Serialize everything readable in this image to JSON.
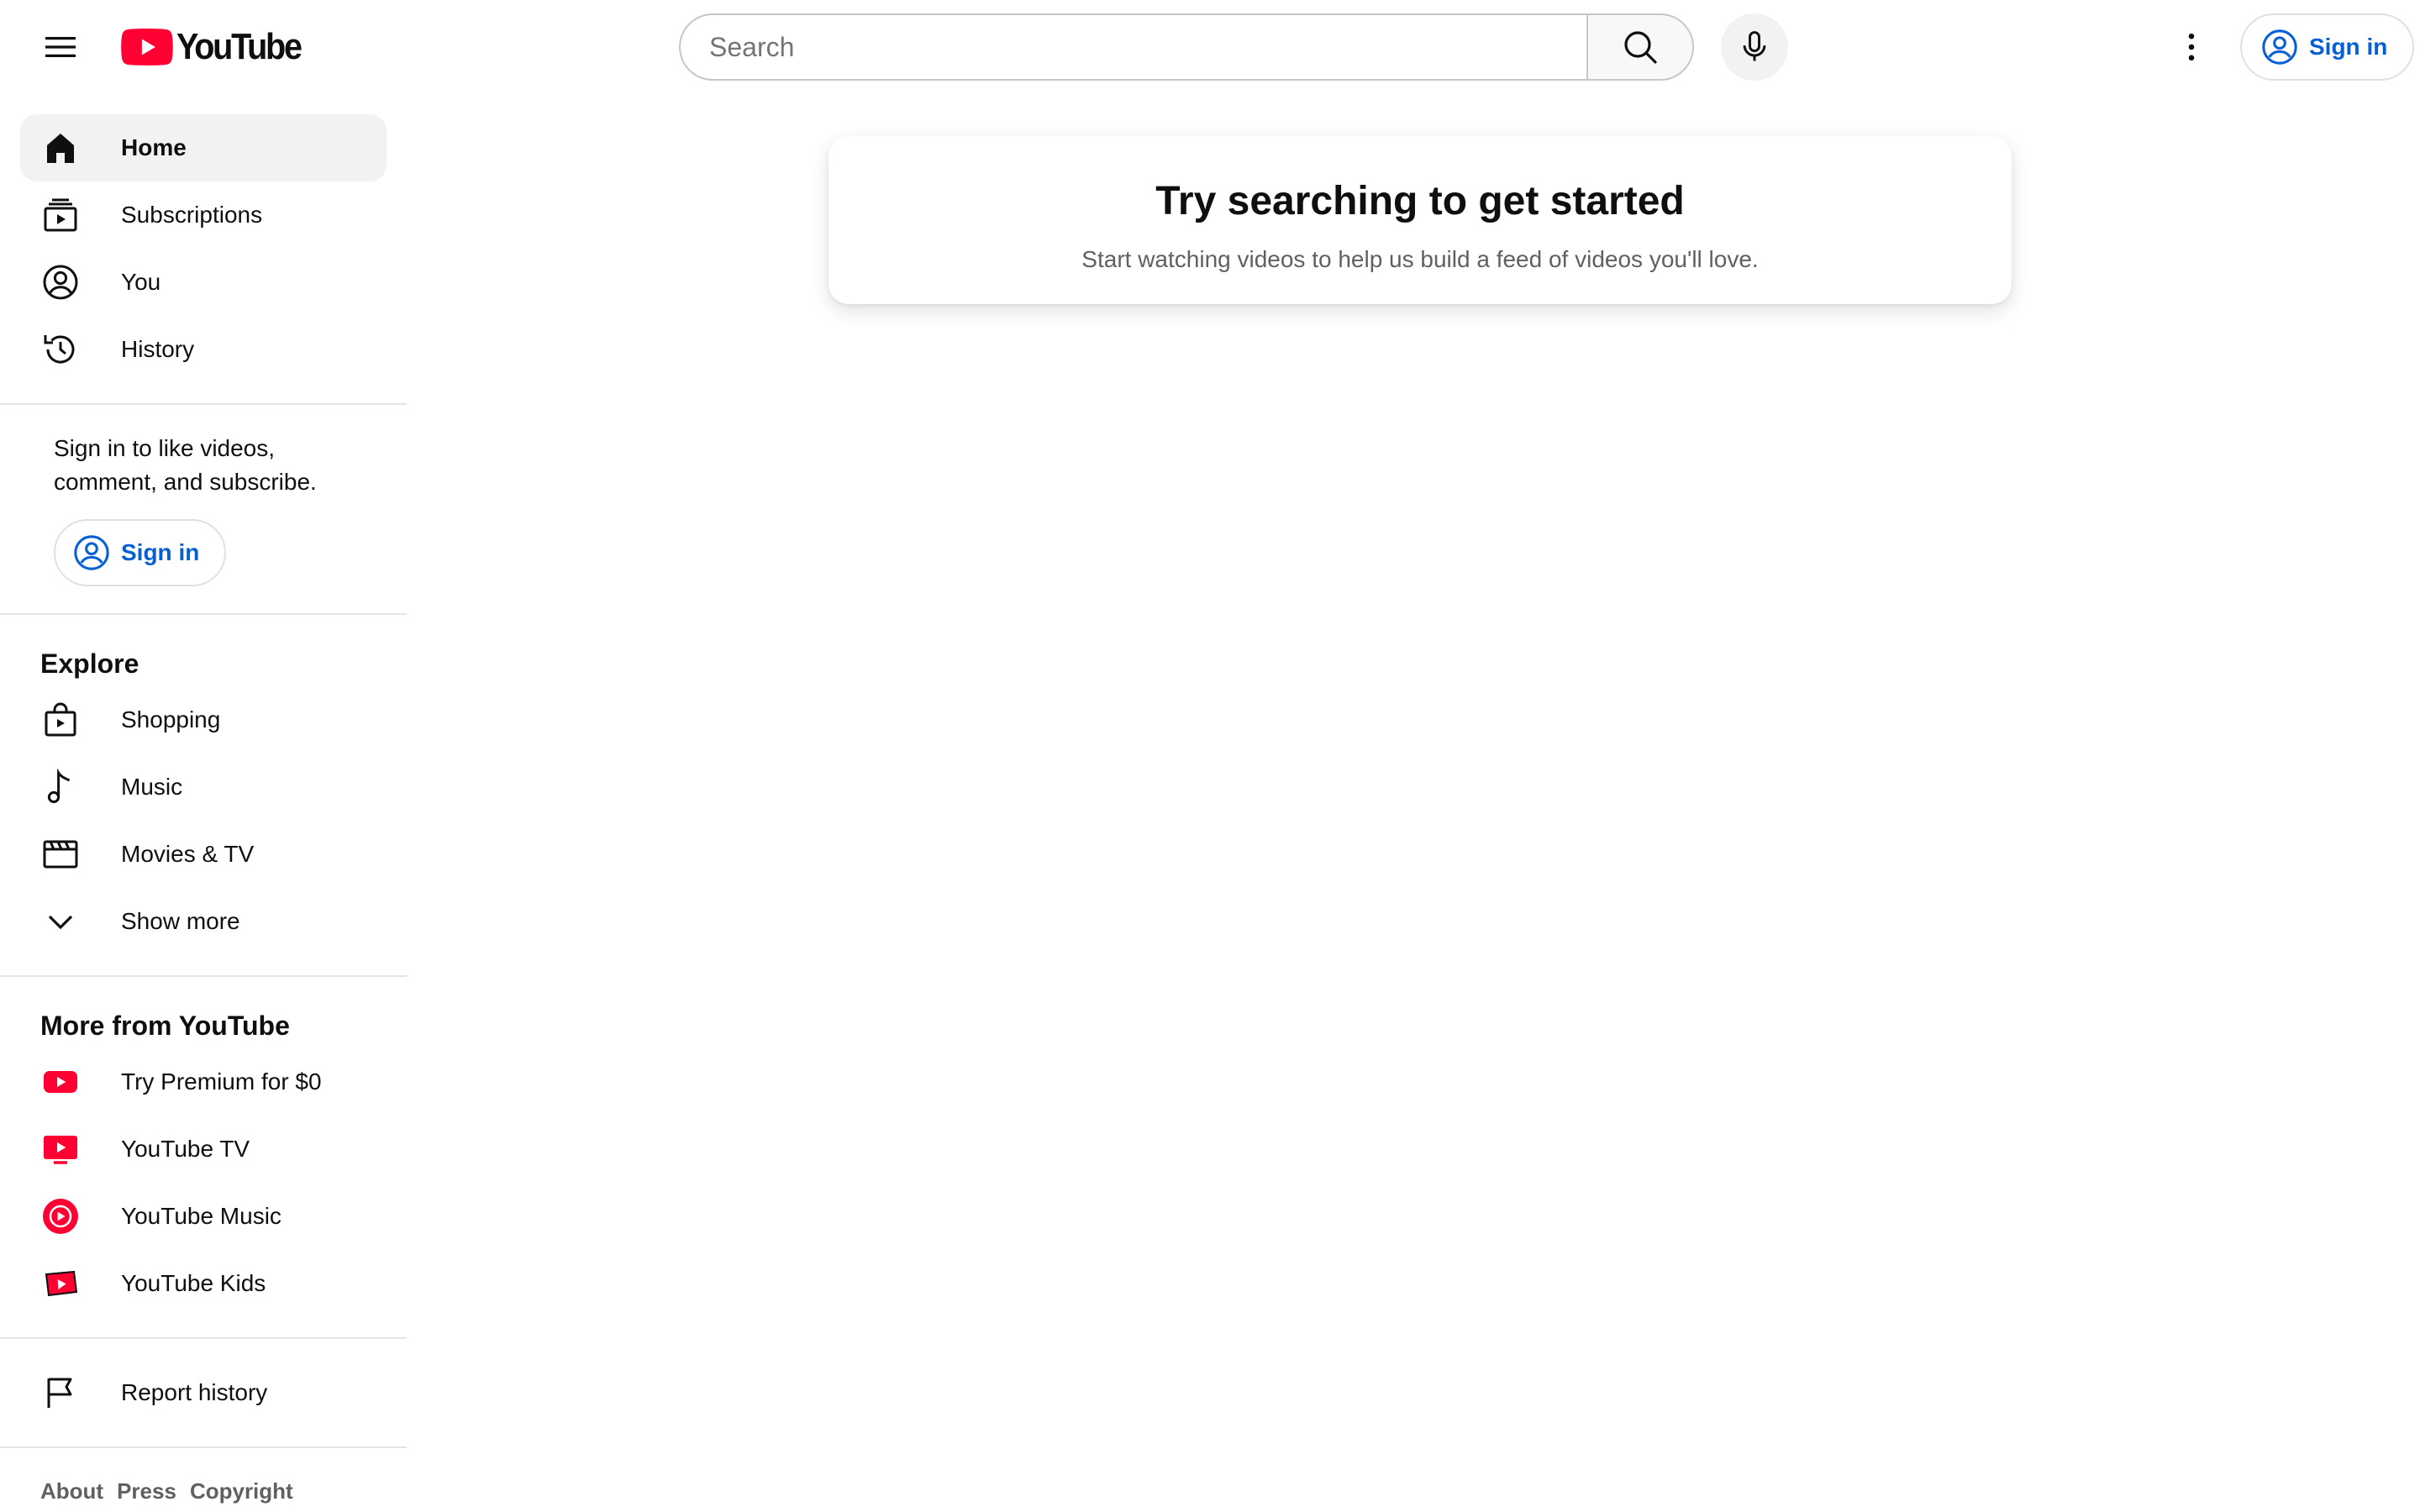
{
  "header": {
    "logo_text": "YouTube",
    "search": {
      "placeholder": "Search",
      "value": ""
    },
    "sign_in_label": "Sign in"
  },
  "sidebar": {
    "main": [
      {
        "label": "Home",
        "icon": "home-icon",
        "active": true
      },
      {
        "label": "Subscriptions",
        "icon": "subscriptions-icon"
      },
      {
        "label": "You",
        "icon": "account-circle-icon"
      },
      {
        "label": "History",
        "icon": "history-icon"
      }
    ],
    "signin_promo": {
      "text": "Sign in to like videos, comment, and subscribe.",
      "button_label": "Sign in"
    },
    "explore": {
      "title": "Explore",
      "items": [
        {
          "label": "Shopping",
          "icon": "shopping-bag-icon"
        },
        {
          "label": "Music",
          "icon": "music-note-icon"
        },
        {
          "label": "Movies & TV",
          "icon": "clapperboard-icon"
        },
        {
          "label": "Show more",
          "icon": "chevron-down-icon"
        }
      ]
    },
    "more_from_youtube": {
      "title": "More from YouTube",
      "items": [
        {
          "label": "Try Premium for $0",
          "icon": "youtube-premium-icon"
        },
        {
          "label": "YouTube TV",
          "icon": "youtube-tv-icon"
        },
        {
          "label": "YouTube Music",
          "icon": "youtube-music-icon"
        },
        {
          "label": "YouTube Kids",
          "icon": "youtube-kids-icon"
        }
      ]
    },
    "report": {
      "label": "Report history",
      "icon": "flag-icon"
    },
    "footer_links": [
      "About",
      "Press",
      "Copyright"
    ]
  },
  "main": {
    "empty_title": "Try searching to get started",
    "empty_subtitle": "Start watching videos to help us build a feed of videos you'll love."
  },
  "colors": {
    "brand_red": "#ff0033",
    "link_blue": "#065fd4",
    "active_bg": "#f2f2f2"
  }
}
